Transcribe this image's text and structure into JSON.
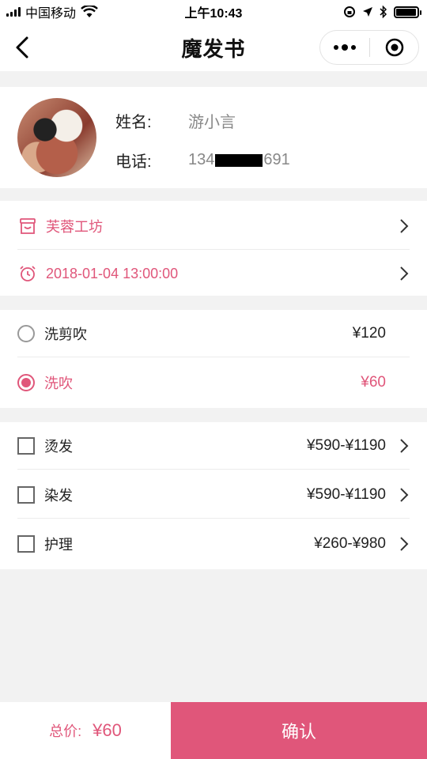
{
  "status_bar": {
    "carrier": "中国移动",
    "time": "上午10:43",
    "battery_level": 0.95
  },
  "nav": {
    "title": "魔发书",
    "back_icon": "chevron-left-icon",
    "more_icon": "more-dots-icon",
    "close_icon": "target-circle-icon"
  },
  "profile": {
    "name_label": "姓名:",
    "name_value": "游小言",
    "phone_label": "电话:",
    "phone_prefix": "134",
    "phone_suffix": "691"
  },
  "booking": {
    "shop_name": "芙蓉工坊",
    "shop_icon": "store-icon",
    "datetime": "2018-01-04 13:00:00",
    "datetime_icon": "alarm-clock-icon"
  },
  "services": [
    {
      "name": "洗剪吹",
      "price": "¥120",
      "selected": false
    },
    {
      "name": "洗吹",
      "price": "¥60",
      "selected": true
    }
  ],
  "extras": [
    {
      "name": "烫发",
      "price": "¥590-¥1190",
      "checked": false
    },
    {
      "name": "染发",
      "price": "¥590-¥1190",
      "checked": false
    },
    {
      "name": "护理",
      "price": "¥260-¥980",
      "checked": false
    }
  ],
  "footer": {
    "total_label": "总价:",
    "total_value": "¥60",
    "confirm_label": "确认"
  },
  "colors": {
    "accent": "#e0567a",
    "background": "#f2f2f2"
  }
}
